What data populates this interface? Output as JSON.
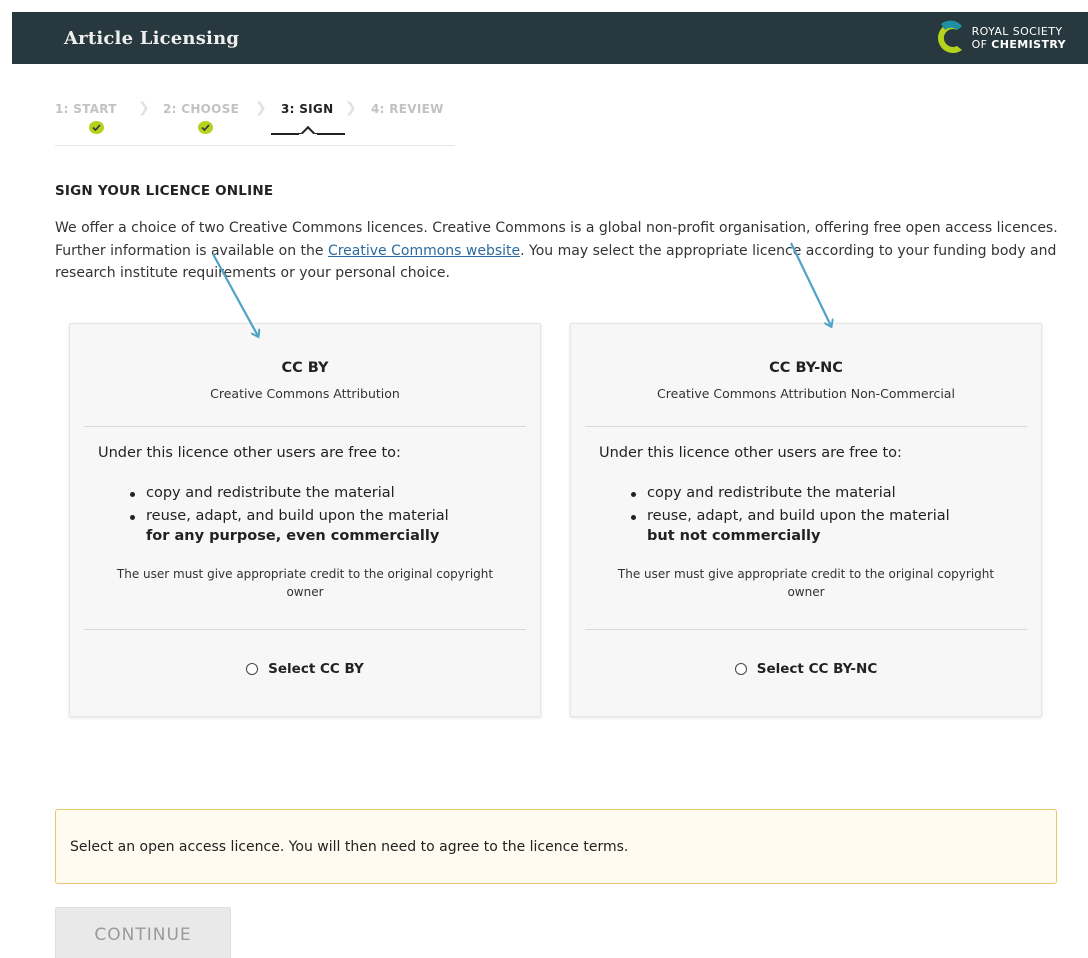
{
  "header": {
    "title": "Article Licensing",
    "logo_line1": "ROYAL SOCIETY",
    "logo_line2_prefix": "OF",
    "logo_line2_bold": "CHEMISTRY"
  },
  "steps": [
    {
      "label": "1: START",
      "status": "complete"
    },
    {
      "label": "2: CHOOSE",
      "status": "complete"
    },
    {
      "label": "3: SIGN",
      "status": "current"
    },
    {
      "label": "4: REVIEW",
      "status": "upcoming"
    }
  ],
  "section": {
    "heading": "SIGN YOUR LICENCE ONLINE",
    "intro_before_link": "We offer a choice of two Creative Commons licences. Creative Commons is a global non-profit organisation, offering free open access licences. Further information is available on the ",
    "intro_link": "Creative Commons website",
    "intro_after_link": ". You may select the appropriate licence according to your funding body and research institute requirements or your personal choice."
  },
  "licences": [
    {
      "name": "CC BY",
      "full_name": "Creative Commons Attribution",
      "free_to": "Under this licence other users are free to:",
      "bullets": [
        "copy and redistribute the material",
        "reuse, adapt, and build upon the material"
      ],
      "purpose": "for any purpose, even commercially",
      "credit": "The user must give appropriate credit to the original copyright owner",
      "select_label": "Select CC BY"
    },
    {
      "name": "CC BY-NC",
      "full_name": "Creative Commons Attribution Non-Commercial",
      "free_to": "Under this licence other users are free to:",
      "bullets": [
        "copy and redistribute the material",
        "reuse, adapt, and build upon the material"
      ],
      "purpose": "but not commercially",
      "credit": "The user must give appropriate credit to the original copyright owner",
      "select_label": "Select CC BY-NC"
    }
  ],
  "notice": "Select an open access licence. You will then need to agree to the licence terms.",
  "continue_label": "CONTINUE",
  "colors": {
    "header_bg": "#27393e",
    "check_green": "#b5d21c",
    "annotation_arrow": "#4fa3c7",
    "notice_border": "#e8c76a",
    "link": "#2b6a9e"
  }
}
